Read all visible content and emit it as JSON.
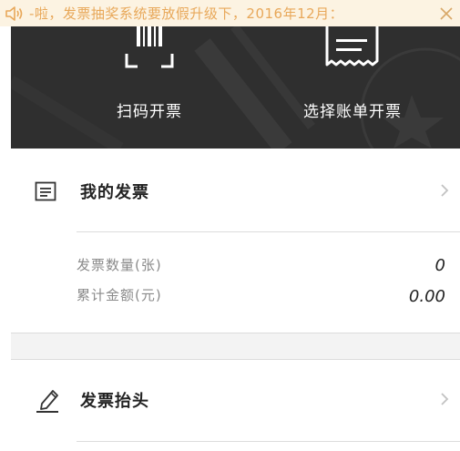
{
  "notice": {
    "text": "-啦，发票抽奖系统要放假升级下，2016年12月：",
    "speaker_icon": "speaker-icon",
    "close_icon": "close-icon",
    "text_color": "#e8a85a",
    "background": "#fcf3e2"
  },
  "header": {
    "background": "#2f2f2f",
    "actions": [
      {
        "label": "扫码开票",
        "icon": "barcode-scan-icon"
      },
      {
        "label": "选择账单开票",
        "icon": "receipt-icon"
      }
    ]
  },
  "my_invoices": {
    "title": "我的发票",
    "icon": "invoice-list-icon",
    "stats": [
      {
        "label": "发票数量(张)",
        "value": "0"
      },
      {
        "label": "累计金额(元)",
        "value": "0.00"
      }
    ]
  },
  "invoice_header": {
    "title": "发票抬头",
    "icon": "pencil-icon"
  }
}
